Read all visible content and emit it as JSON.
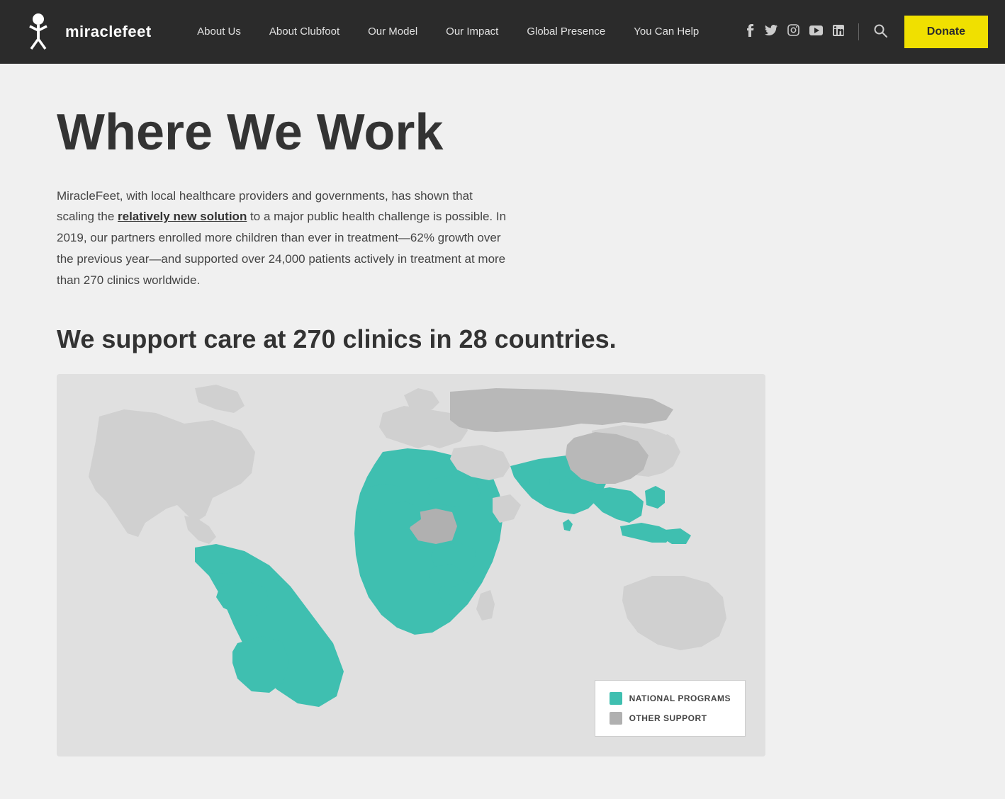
{
  "nav": {
    "logo_text": "miraclefeet",
    "links": [
      {
        "label": "About Us",
        "href": "#"
      },
      {
        "label": "About Clubfoot",
        "href": "#"
      },
      {
        "label": "Our Model",
        "href": "#"
      },
      {
        "label": "Our Impact",
        "href": "#"
      },
      {
        "label": "Global Presence",
        "href": "#"
      },
      {
        "label": "You Can Help",
        "href": "#"
      }
    ],
    "donate_label": "Donate"
  },
  "social": [
    {
      "name": "facebook-icon",
      "symbol": "f"
    },
    {
      "name": "twitter-icon",
      "symbol": "t"
    },
    {
      "name": "instagram-icon",
      "symbol": "ig"
    },
    {
      "name": "youtube-icon",
      "symbol": "yt"
    },
    {
      "name": "linkedin-icon",
      "symbol": "in"
    }
  ],
  "main": {
    "page_title": "Where We Work",
    "intro_paragraph": "MiracleFeet, with local healthcare providers and governments, has shown that scaling the ",
    "intro_link_text": "relatively new solution",
    "intro_paragraph_cont": " to a major public health challenge is possible. In 2019, our partners enrolled more children than ever in treatment—62% growth over the previous year—and supported over 24,000 patients actively in treatment at more than 270 clinics worldwide.",
    "subtitle": "We support care at 270 clinics in 28 countries.",
    "legend_national": "NATIONAL PROGRAMS",
    "legend_other": "OTHER SUPPORT"
  },
  "colors": {
    "teal": "#3fbfb0",
    "gray_support": "#b0b0b0",
    "dark_bg": "#2b2b2b",
    "donate_yellow": "#f0e000"
  }
}
